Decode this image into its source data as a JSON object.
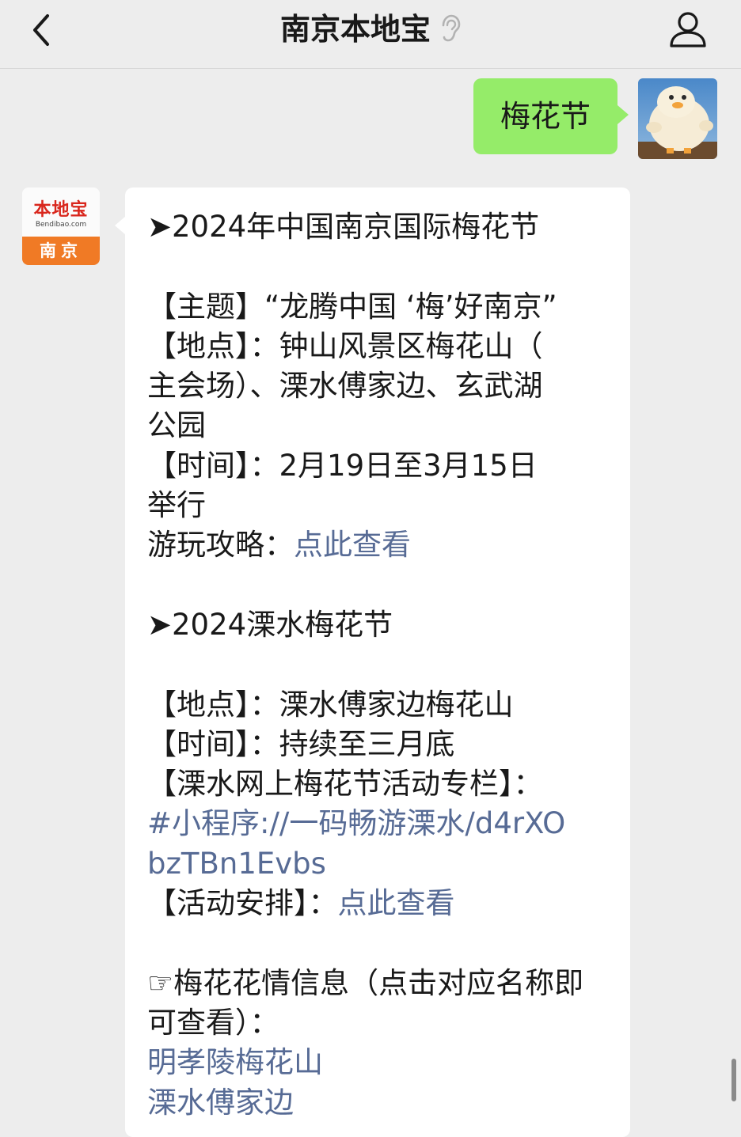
{
  "header": {
    "title": "南京本地宝"
  },
  "outgoing": {
    "text": "梅花节"
  },
  "bot": {
    "avatar_logo": "本地宝",
    "avatar_logo_sub": "Bendibao.com",
    "avatar_city": "南京"
  },
  "message": {
    "s1_heading": "➤2024年中国南京国际梅花节",
    "s1_theme": "【主题】“龙腾中国 ‘梅’好南京”",
    "s1_place_1": "【地点】：钟山风景区梅花山（",
    "s1_place_2": "主会场）、溧水傅家边、玄武湖",
    "s1_place_3": "公园",
    "s1_time_1": "【时间】：2月19日至3月15日",
    "s1_time_2": "举行",
    "s1_guide_label": "游玩攻略：",
    "s1_guide_link": "点此查看",
    "s2_heading": "➤2024溧水梅花节",
    "s2_place": "【地点】：溧水傅家边梅花山",
    "s2_time": "【时间】：持续至三月底",
    "s2_column": "【溧水网上梅花节活动专栏】：",
    "s2_mini_1": "#小程序://一码畅游溧水/d4rXO",
    "s2_mini_2": "bzTBn1Evbs",
    "s2_schedule_label": "【活动安排】：",
    "s2_schedule_link": "点此查看",
    "s3_info_1": "☞梅花花情信息（点击对应名称即",
    "s3_info_2": "可查看）：",
    "s3_link_1": "明孝陵梅花山",
    "s3_link_2": "溧水傅家边"
  },
  "colors": {
    "background": "#ededed",
    "outgoing_bubble": "#95ec69",
    "incoming_bubble": "#ffffff",
    "link": "#576b95",
    "avatar_brand_red": "#d9261c",
    "avatar_brand_orange": "#f07a25"
  },
  "icons": {
    "back": "chevron-left-icon",
    "listen": "ear-icon",
    "profile": "person-icon"
  }
}
